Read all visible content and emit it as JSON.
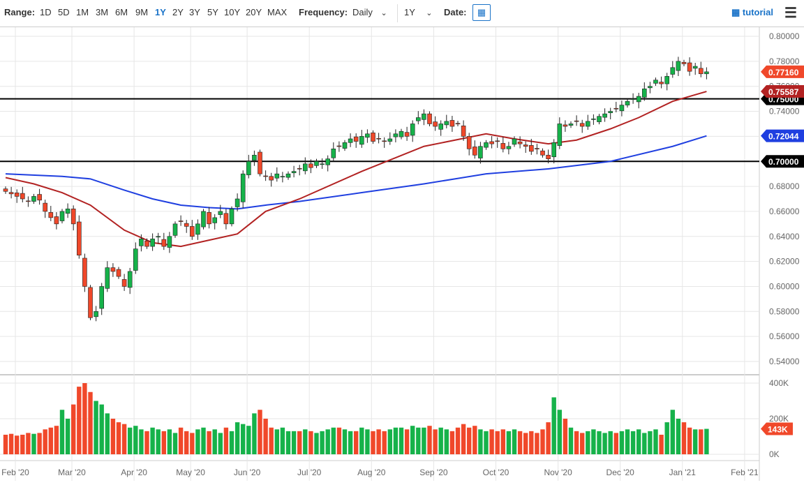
{
  "toolbar": {
    "range_label": "Range:",
    "ranges": [
      "1D",
      "5D",
      "1M",
      "3M",
      "6M",
      "9M",
      "1Y",
      "2Y",
      "3Y",
      "5Y",
      "10Y",
      "20Y",
      "MAX"
    ],
    "selected_range": "1Y",
    "frequency_label": "Frequency:",
    "frequency_value": "Daily",
    "period_value": "1Y",
    "date_label": "Date:",
    "tutorial": "tutorial"
  },
  "colors": {
    "up": "#16b24a",
    "down": "#f0482a",
    "ma50": "#b22222",
    "ma200": "#1f3fe0",
    "accent": "#1a73c8"
  },
  "chart_data": {
    "type": "candlestick",
    "price_ticks": [
      "0.80000",
      "0.78000",
      "0.76000",
      "0.74000",
      "0.72000",
      "0.70000",
      "0.68000",
      "0.66000",
      "0.64000",
      "0.62000",
      "0.60000",
      "0.58000",
      "0.56000",
      "0.54000"
    ],
    "ylim": [
      0.535,
      0.8
    ],
    "x_labels": [
      "Feb '20",
      "Mar '20",
      "Apr '20",
      "May '20",
      "Jun '20",
      "Jul '20",
      "Aug '20",
      "Sep '20",
      "Oct '20",
      "Nov '20",
      "Dec '20",
      "Jan '21",
      "Feb '21"
    ],
    "x_label_index": [
      0,
      10,
      21,
      31,
      41,
      52,
      63,
      74,
      85,
      96,
      107,
      118,
      129
    ],
    "closes": [
      0.676,
      0.674,
      0.672,
      0.67,
      0.668,
      0.672,
      0.669,
      0.66,
      0.655,
      0.65,
      0.66,
      0.662,
      0.65,
      0.625,
      0.6,
      0.575,
      0.58,
      0.6,
      0.615,
      0.612,
      0.608,
      0.6,
      0.612,
      0.63,
      0.638,
      0.632,
      0.638,
      0.64,
      0.632,
      0.64,
      0.65,
      0.652,
      0.648,
      0.64,
      0.65,
      0.66,
      0.65,
      0.655,
      0.66,
      0.65,
      0.662,
      0.67,
      0.69,
      0.7,
      0.705,
      0.69,
      0.688,
      0.685,
      0.69,
      0.688,
      0.69,
      0.692,
      0.694,
      0.698,
      0.695,
      0.7,
      0.698,
      0.702,
      0.71,
      0.712,
      0.715,
      0.718,
      0.716,
      0.72,
      0.722,
      0.716,
      0.718,
      0.716,
      0.718,
      0.722,
      0.724,
      0.72,
      0.73,
      0.735,
      0.738,
      0.73,
      0.728,
      0.73,
      0.732,
      0.728,
      0.73,
      0.72,
      0.71,
      0.705,
      0.712,
      0.715,
      0.714,
      0.716,
      0.71,
      0.712,
      0.718,
      0.714,
      0.712,
      0.708,
      0.71,
      0.705,
      0.702,
      0.715,
      0.73,
      0.728,
      0.73,
      0.732,
      0.728,
      0.732,
      0.734,
      0.736,
      0.738,
      0.74,
      0.742,
      0.745,
      0.748,
      0.75,
      0.752,
      0.758,
      0.76,
      0.765,
      0.762,
      0.768,
      0.775,
      0.78,
      0.778,
      0.772,
      0.776,
      0.77,
      0.7716
    ],
    "volumes_k": [
      110,
      115,
      105,
      110,
      120,
      115,
      120,
      140,
      150,
      160,
      250,
      200,
      280,
      380,
      400,
      350,
      300,
      280,
      230,
      200,
      180,
      170,
      150,
      160,
      140,
      130,
      150,
      140,
      130,
      140,
      120,
      150,
      130,
      120,
      140,
      150,
      130,
      140,
      120,
      150,
      130,
      180,
      170,
      160,
      230,
      250,
      200,
      150,
      140,
      150,
      130,
      130,
      130,
      140,
      130,
      120,
      130,
      140,
      150,
      150,
      140,
      130,
      130,
      150,
      140,
      130,
      140,
      130,
      140,
      150,
      150,
      140,
      160,
      150,
      150,
      160,
      140,
      150,
      140,
      130,
      150,
      170,
      150,
      160,
      140,
      130,
      140,
      130,
      140,
      130,
      140,
      130,
      120,
      130,
      120,
      140,
      180,
      320,
      250,
      200,
      150,
      130,
      120,
      130,
      140,
      130,
      120,
      130,
      120,
      130,
      140,
      130,
      140,
      120,
      130,
      140,
      110,
      180,
      250,
      200,
      180,
      150,
      140,
      140,
      143
    ],
    "ma50": [
      [
        0,
        0.687
      ],
      [
        5,
        0.682
      ],
      [
        10,
        0.675
      ],
      [
        15,
        0.665
      ],
      [
        21,
        0.645
      ],
      [
        26,
        0.635
      ],
      [
        31,
        0.632
      ],
      [
        36,
        0.637
      ],
      [
        41,
        0.642
      ],
      [
        46,
        0.66
      ],
      [
        52,
        0.67
      ],
      [
        63,
        0.692
      ],
      [
        74,
        0.712
      ],
      [
        85,
        0.722
      ],
      [
        90,
        0.718
      ],
      [
        96,
        0.714
      ],
      [
        101,
        0.717
      ],
      [
        107,
        0.726
      ],
      [
        112,
        0.735
      ],
      [
        118,
        0.748
      ],
      [
        124,
        0.7559
      ]
    ],
    "ma200": [
      [
        0,
        0.69
      ],
      [
        10,
        0.688
      ],
      [
        15,
        0.686
      ],
      [
        21,
        0.677
      ],
      [
        26,
        0.67
      ],
      [
        31,
        0.665
      ],
      [
        36,
        0.663
      ],
      [
        41,
        0.662
      ],
      [
        46,
        0.665
      ],
      [
        52,
        0.668
      ],
      [
        63,
        0.675
      ],
      [
        74,
        0.682
      ],
      [
        85,
        0.69
      ],
      [
        96,
        0.694
      ],
      [
        107,
        0.7
      ],
      [
        118,
        0.712
      ],
      [
        124,
        0.7204
      ]
    ],
    "horizontal_lines": [
      0.75,
      0.7
    ],
    "badges": {
      "last": "0.77160",
      "ma50": "0.75587",
      "ma200": "0.72044",
      "level_075": "0.75000",
      "level_070": "0.70000"
    },
    "volume_ticks": [
      "400K",
      "200K",
      "0K"
    ],
    "volume_last": "143K"
  }
}
